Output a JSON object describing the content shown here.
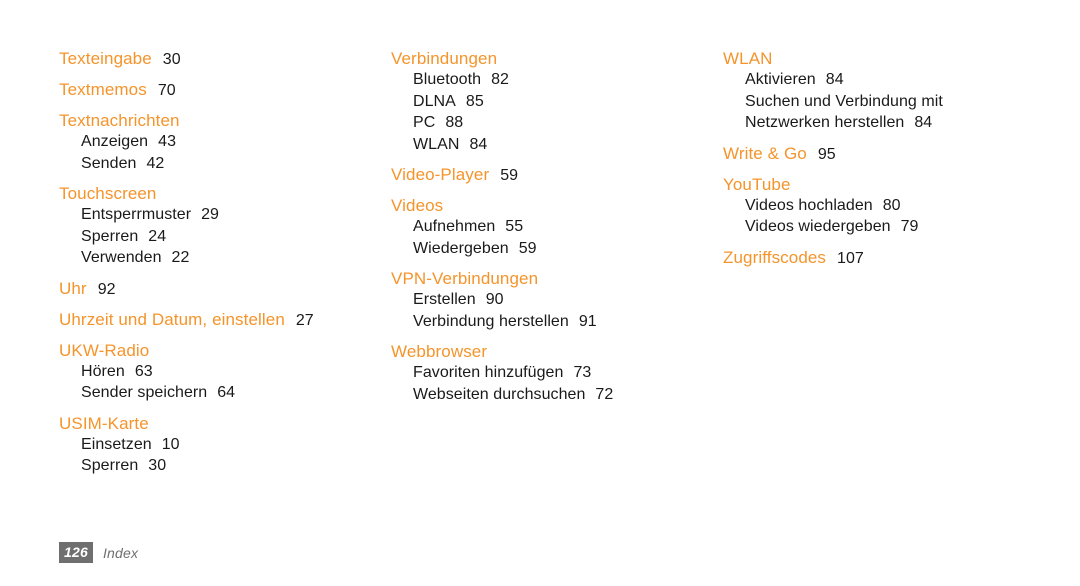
{
  "document": {
    "type": "book-index",
    "language": "de",
    "page_number": "126",
    "footer_label": "Index",
    "accent_color": "#f5942b",
    "text_color": "#1a1a1a",
    "footer_color": "#6f6f6f",
    "background_color": "#ffffff"
  },
  "columns": [
    {
      "id": "column-1",
      "groups": [
        {
          "heading": "Texteingabe",
          "heading_page": "30",
          "entries": []
        },
        {
          "heading": "Textmemos",
          "heading_page": "70",
          "entries": []
        },
        {
          "heading": "Textnachrichten",
          "heading_page": "",
          "entries": [
            {
              "label": "Anzeigen",
              "page": "43"
            },
            {
              "label": "Senden",
              "page": "42"
            }
          ]
        },
        {
          "heading": "Touchscreen",
          "heading_page": "",
          "entries": [
            {
              "label": "Entsperrmuster",
              "page": "29"
            },
            {
              "label": "Sperren",
              "page": "24"
            },
            {
              "label": "Verwenden",
              "page": "22"
            }
          ]
        },
        {
          "heading": "Uhr",
          "heading_page": "92",
          "entries": []
        },
        {
          "heading": "Uhrzeit und Datum, einstellen",
          "heading_page": "27",
          "entries": []
        },
        {
          "heading": "UKW-Radio",
          "heading_page": "",
          "entries": [
            {
              "label": "Hören",
              "page": "63"
            },
            {
              "label": "Sender speichern",
              "page": "64"
            }
          ]
        },
        {
          "heading": "USIM-Karte",
          "heading_page": "",
          "entries": [
            {
              "label": "Einsetzen",
              "page": "10"
            },
            {
              "label": "Sperren",
              "page": "30"
            }
          ]
        }
      ]
    },
    {
      "id": "column-2",
      "groups": [
        {
          "heading": "Verbindungen",
          "heading_page": "",
          "entries": [
            {
              "label": "Bluetooth",
              "page": "82"
            },
            {
              "label": "DLNA",
              "page": "85"
            },
            {
              "label": "PC",
              "page": "88"
            },
            {
              "label": "WLAN",
              "page": "84"
            }
          ]
        },
        {
          "heading": "Video-Player",
          "heading_page": "59",
          "entries": []
        },
        {
          "heading": "Videos",
          "heading_page": "",
          "entries": [
            {
              "label": "Aufnehmen",
              "page": "55"
            },
            {
              "label": "Wiedergeben",
              "page": "59"
            }
          ]
        },
        {
          "heading": "VPN-Verbindungen",
          "heading_page": "",
          "entries": [
            {
              "label": "Erstellen",
              "page": "90"
            },
            {
              "label": "Verbindung herstellen",
              "page": "91"
            }
          ]
        },
        {
          "heading": "Webbrowser",
          "heading_page": "",
          "entries": [
            {
              "label": "Favoriten hinzufügen",
              "page": "73"
            },
            {
              "label": "Webseiten durchsuchen",
              "page": "72"
            }
          ]
        }
      ]
    },
    {
      "id": "column-3",
      "groups": [
        {
          "heading": "WLAN",
          "heading_page": "",
          "entries": [
            {
              "label": "Aktivieren",
              "page": "84"
            },
            {
              "label": "Suchen und Verbindung mit Netzwerken herstellen",
              "page": "84",
              "wrap": true
            }
          ]
        },
        {
          "heading": "Write & Go",
          "heading_page": "95",
          "entries": []
        },
        {
          "heading": "YouTube",
          "heading_page": "",
          "entries": [
            {
              "label": "Videos hochladen",
              "page": "80"
            },
            {
              "label": "Videos wiedergeben",
              "page": "79"
            }
          ]
        },
        {
          "heading": "Zugriffscodes",
          "heading_page": "107",
          "entries": []
        }
      ]
    }
  ]
}
